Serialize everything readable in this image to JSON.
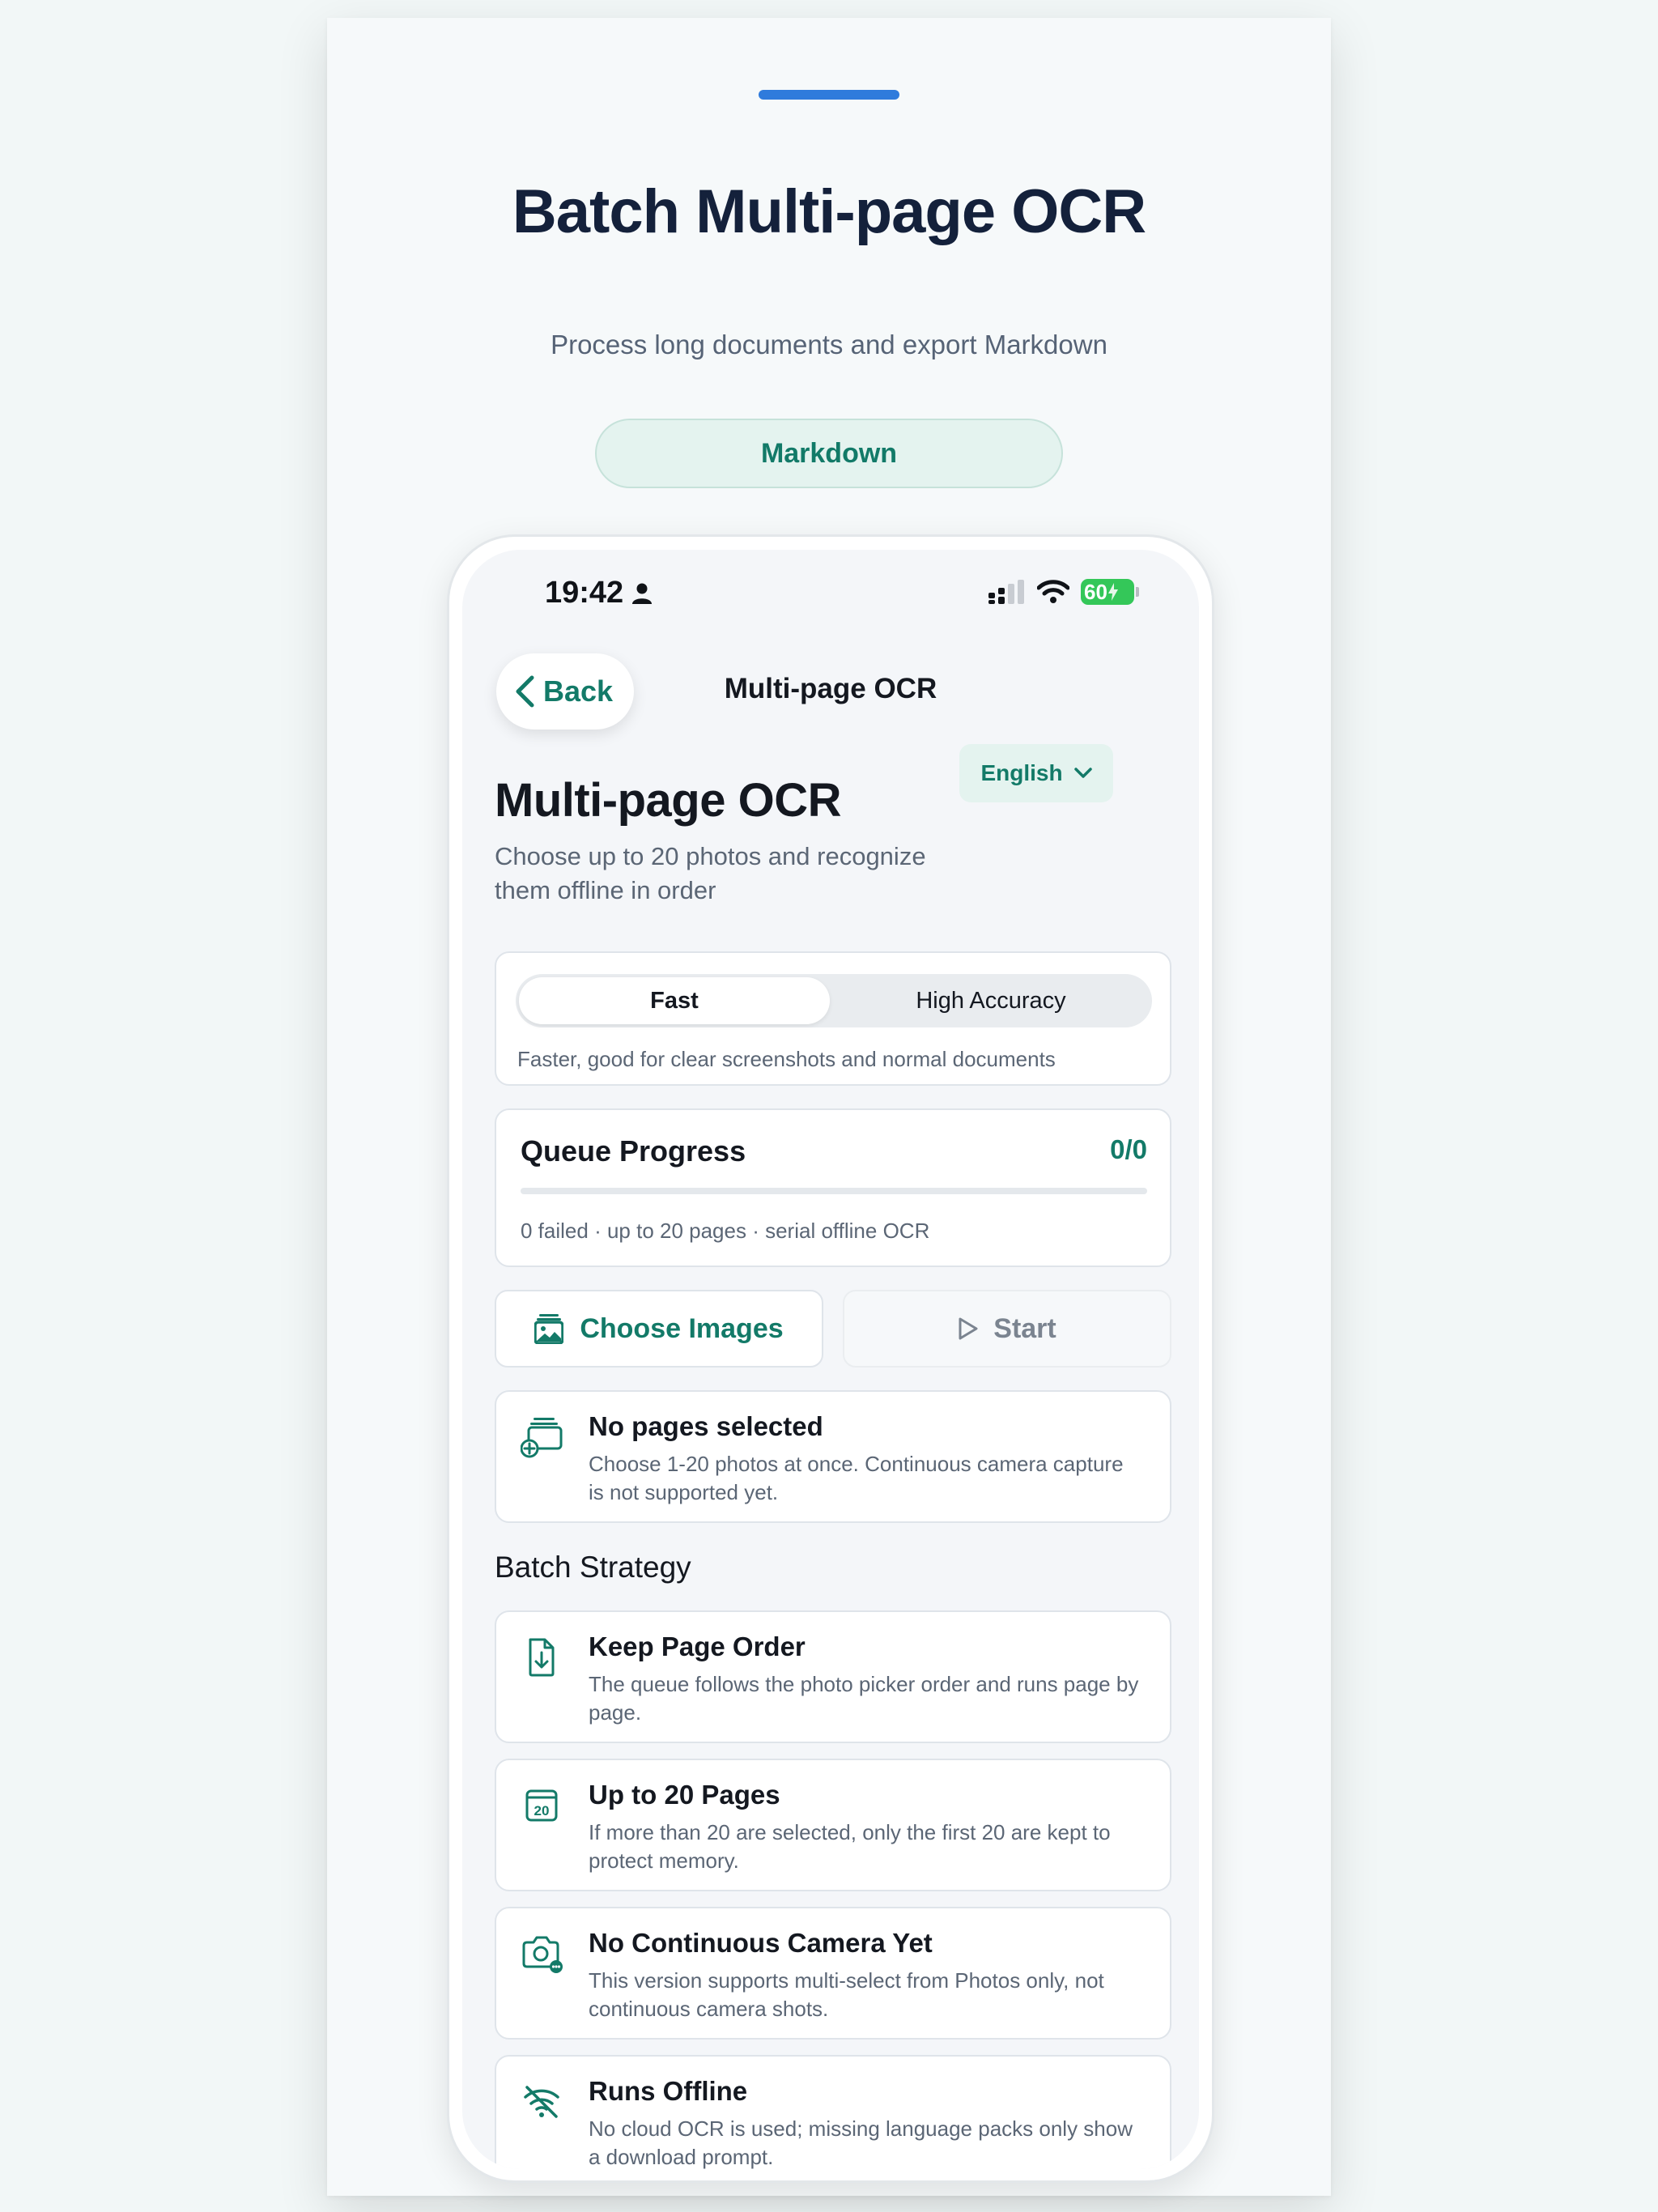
{
  "hero": {
    "title": "Batch Multi-page OCR",
    "subtitle": "Process long documents and export Markdown",
    "pill": "Markdown",
    "accent": "#2f7bdc"
  },
  "status_bar": {
    "time": "19:42",
    "battery": "60"
  },
  "nav": {
    "back_label": "Back",
    "title": "Multi-page OCR"
  },
  "header": {
    "title": "Multi-page OCR",
    "subtitle": "Choose up to 20 photos and recognize them offline in order",
    "language": "English"
  },
  "mode": {
    "options": [
      "Fast",
      "High Accuracy"
    ],
    "selected": "Fast",
    "hint": "Faster, good for clear screenshots and normal documents"
  },
  "queue": {
    "title": "Queue Progress",
    "count": "0/0",
    "progress": 0,
    "meta": "0 failed · up to 20 pages · serial offline OCR"
  },
  "actions": {
    "choose_label": "Choose Images",
    "start_label": "Start"
  },
  "empty_state": {
    "title": "No pages selected",
    "desc": "Choose 1-20 photos at once. Continuous camera capture is not supported yet."
  },
  "strategy": {
    "heading": "Batch Strategy",
    "items": [
      {
        "title": "Keep Page Order",
        "desc": "The queue follows the photo picker order and runs page by page.",
        "icon": "document-download-icon"
      },
      {
        "title": "Up to 20 Pages",
        "desc": "If more than 20 are selected, only the first 20 are kept to protect memory.",
        "icon": "calendar-20-icon"
      },
      {
        "title": "No Continuous Camera Yet",
        "desc": "This version supports multi-select from Photos only, not continuous camera shots.",
        "icon": "camera-icon"
      },
      {
        "title": "Runs Offline",
        "desc": "No cloud OCR is used; missing language packs only show a download prompt.",
        "icon": "wifi-off-icon"
      }
    ]
  },
  "colors": {
    "brand": "#137a68",
    "text": "#141820",
    "muted": "#5b6675"
  }
}
